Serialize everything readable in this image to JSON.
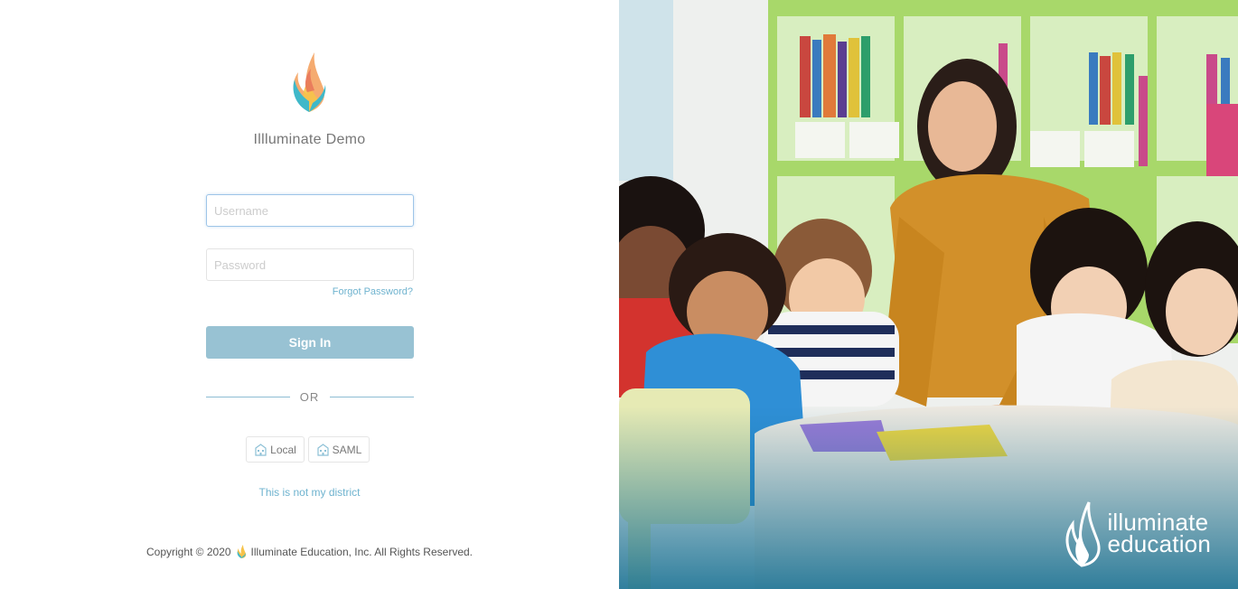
{
  "district": {
    "name": "Illluminate Demo"
  },
  "login": {
    "username_placeholder": "Username",
    "password_placeholder": "Password",
    "forgot_label": "Forgot Password?",
    "signin_label": "Sign In",
    "or_label": "OR"
  },
  "auth_options": [
    {
      "label": "Local",
      "icon": "building-icon"
    },
    {
      "label": "SAML",
      "icon": "building-icon"
    }
  ],
  "not_district_label": "This is not my district",
  "footer": {
    "copyright_prefix": "Copyright © 2020",
    "copyright_suffix": "Illuminate Education, Inc. All Rights Reserved."
  },
  "brand": {
    "line1": "illuminate",
    "line2": "education"
  },
  "colors": {
    "accent": "#6fb3cf",
    "signin_bg": "#98c2d3",
    "flame_orange": "#f4a261",
    "flame_yellow": "#f6c34a",
    "flame_teal": "#3fb8c9"
  }
}
